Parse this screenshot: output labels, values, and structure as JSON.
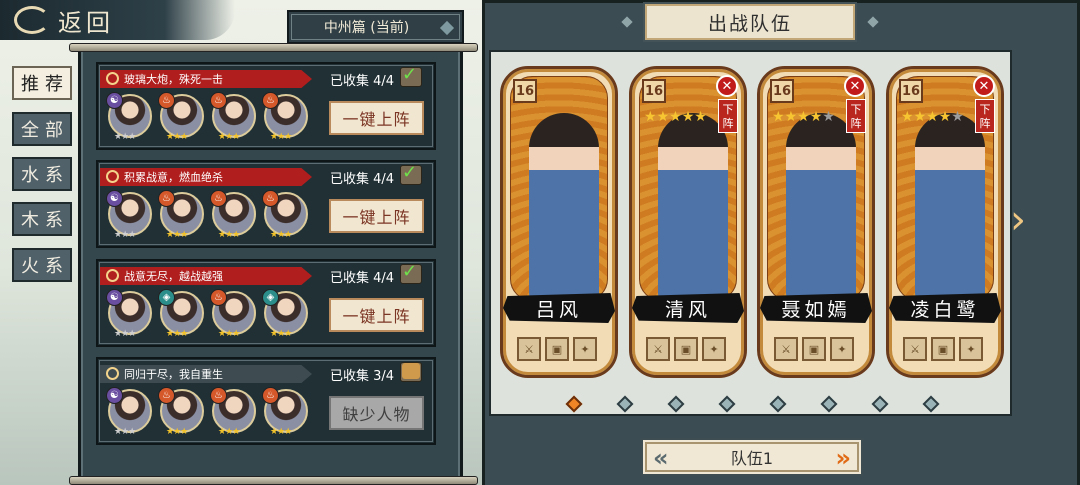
{
  "topbar": {
    "back_label": "返回",
    "chapter_label": "中州篇 (当前)"
  },
  "tabs": [
    {
      "label": "推荐",
      "active": true
    },
    {
      "label": "全部"
    },
    {
      "label": "水系"
    },
    {
      "label": "木系"
    },
    {
      "label": "火系"
    }
  ],
  "teams": [
    {
      "title": "玻璃大炮，殊死一击",
      "collected": "已收集 4/4",
      "action": "一键上阵",
      "complete": true,
      "members": [
        {
          "element": "yin",
          "stars": 3
        },
        {
          "element": "fire",
          "stars": 3
        },
        {
          "element": "fire",
          "stars": 3
        },
        {
          "element": "fire",
          "stars": 3
        }
      ]
    },
    {
      "title": "积累战意，燃血绝杀",
      "collected": "已收集 4/4",
      "action": "一键上阵",
      "complete": true,
      "members": [
        {
          "element": "yin",
          "stars": 3
        },
        {
          "element": "fire",
          "stars": 3
        },
        {
          "element": "fire",
          "stars": 3
        },
        {
          "element": "fire",
          "stars": 3
        }
      ]
    },
    {
      "title": "战意无尽，越战越强",
      "collected": "已收集 4/4",
      "action": "一键上阵",
      "complete": true,
      "members": [
        {
          "element": "yin",
          "stars": 3
        },
        {
          "element": "water",
          "stars": 3
        },
        {
          "element": "fire",
          "stars": 3
        },
        {
          "element": "water",
          "stars": 3
        }
      ]
    },
    {
      "title": "同归于尽，我自重生",
      "collected": "已收集 3/4",
      "action": "缺少人物",
      "complete": false,
      "members": [
        {
          "element": "yin",
          "stars": 3
        },
        {
          "element": "fire",
          "stars": 3
        },
        {
          "element": "fire",
          "stars": 3
        },
        {
          "element": "fire",
          "stars": 3
        }
      ]
    }
  ],
  "lineup": {
    "title": "出战队伍",
    "team_selector": "队伍1",
    "heroes": [
      {
        "name": "吕风",
        "level": "16",
        "stars": 0,
        "removable": false
      },
      {
        "name": "清风",
        "level": "16",
        "stars": 5,
        "removable": true,
        "remove_label": "下阵"
      },
      {
        "name": "聂如嫣",
        "level": "16",
        "stars": 4,
        "removable": true,
        "remove_label": "下阵"
      },
      {
        "name": "凌白鹭",
        "level": "16",
        "stars": 4,
        "removable": true,
        "remove_label": "下阵"
      }
    ],
    "page_count": 8,
    "active_page": 1
  },
  "icons": {
    "back": "swirl-back-icon",
    "next": "chevron-right-icon",
    "chest": "treasure-chest-icon",
    "check": "check-icon",
    "lock": "lock-icon"
  },
  "colors": {
    "banner_red": "#b01e1e",
    "accent_orange": "#ee8426",
    "panel_dark": "#34474c"
  }
}
